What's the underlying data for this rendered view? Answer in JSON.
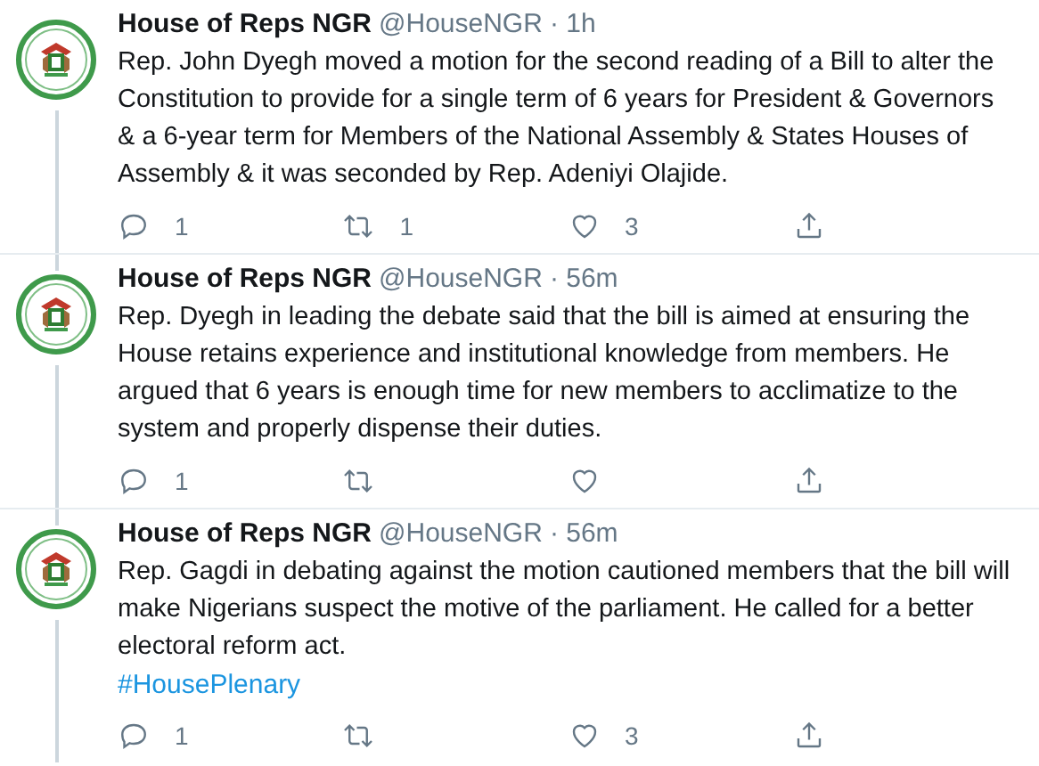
{
  "tweets": [
    {
      "name": "House of Reps NGR",
      "handle": "@HouseNGR",
      "time": "· 1h",
      "text": "Rep. John Dyegh moved a motion for the second reading of a Bill to alter the Constitution to provide for a single term of 6 years for President & Governors & a 6-year term for Members of the National Assembly & States Houses of Assembly & it was seconded by Rep. Adeniyi Olajide.",
      "replies": "1",
      "retweets": "1",
      "likes": "3"
    },
    {
      "name": "House of Reps NGR",
      "handle": "@HouseNGR",
      "time": "· 56m",
      "text": "Rep. Dyegh in leading the debate said that the bill is aimed at ensuring the House retains experience and institutional knowledge from members. He argued that 6 years is enough time for new members to acclimatize to the system and properly dispense their duties.",
      "replies": "1"
    },
    {
      "name": "House of Reps NGR",
      "handle": "@HouseNGR",
      "time": "· 56m",
      "text": "Rep. Gagdi in debating against the motion cautioned members that the bill will make Nigerians suspect the motive of the parliament. He called for a better electoral reform act.",
      "hashtag": "#HousePlenary",
      "replies": "1",
      "likes": "3"
    }
  ]
}
